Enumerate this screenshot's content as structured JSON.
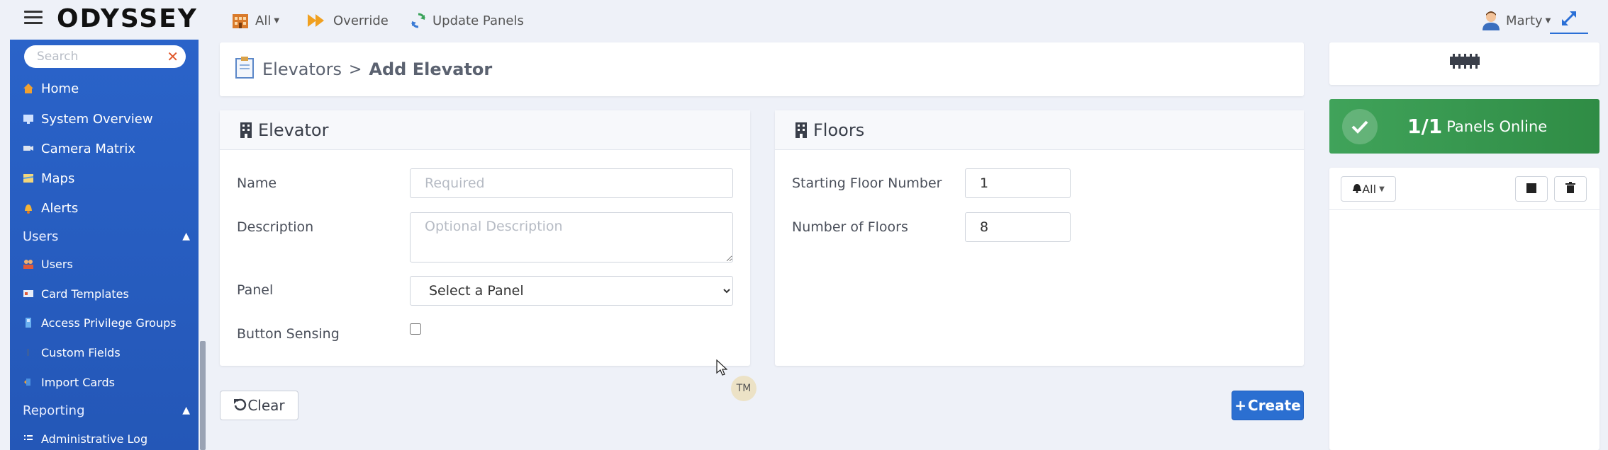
{
  "topbar": {
    "logo": "ODYSSEY",
    "filter_label": "All",
    "override_label": "Override",
    "update_panels_label": "Update Panels",
    "user_name": "Marty"
  },
  "sidebar": {
    "search_placeholder": "Search",
    "items": [
      {
        "label": "Home",
        "icon": "home-icon"
      },
      {
        "label": "System Overview",
        "icon": "system-overview-icon"
      },
      {
        "label": "Camera Matrix",
        "icon": "camera-icon"
      },
      {
        "label": "Maps",
        "icon": "map-icon"
      },
      {
        "label": "Alerts",
        "icon": "bell-icon"
      }
    ],
    "users_section": "Users",
    "users_items": [
      {
        "label": "Users",
        "icon": "users-icon"
      },
      {
        "label": "Card Templates",
        "icon": "card-icon"
      },
      {
        "label": "Access Privilege Groups",
        "icon": "key-icon"
      },
      {
        "label": "Custom Fields",
        "icon": "field-icon"
      },
      {
        "label": "Import Cards",
        "icon": "import-icon"
      }
    ],
    "reporting_section": "Reporting",
    "reporting_items": [
      {
        "label": "Administrative Log",
        "icon": "log-icon"
      }
    ]
  },
  "breadcrumb": {
    "parent": "Elevators",
    "separator": ">",
    "current": "Add Elevator"
  },
  "elevator_card": {
    "title": "Elevator",
    "name_label": "Name",
    "name_placeholder": "Required",
    "description_label": "Description",
    "description_placeholder": "Optional Description",
    "panel_label": "Panel",
    "panel_selected": "Select a Panel",
    "button_sensing_label": "Button Sensing"
  },
  "floors_card": {
    "title": "Floors",
    "starting_floor_label": "Starting Floor Number",
    "starting_floor_value": "1",
    "num_floors_label": "Number of Floors",
    "num_floors_value": "8"
  },
  "actions": {
    "clear_label": "Clear",
    "create_label": "Create"
  },
  "tm_badge": "TM",
  "panels_status": {
    "count": "1/1",
    "text": "Panels Online"
  },
  "events": {
    "filter_label": "All"
  },
  "colors": {
    "sidebar": "#2a63c9",
    "accent": "#2b6fd1",
    "online": "#3a9b52"
  }
}
